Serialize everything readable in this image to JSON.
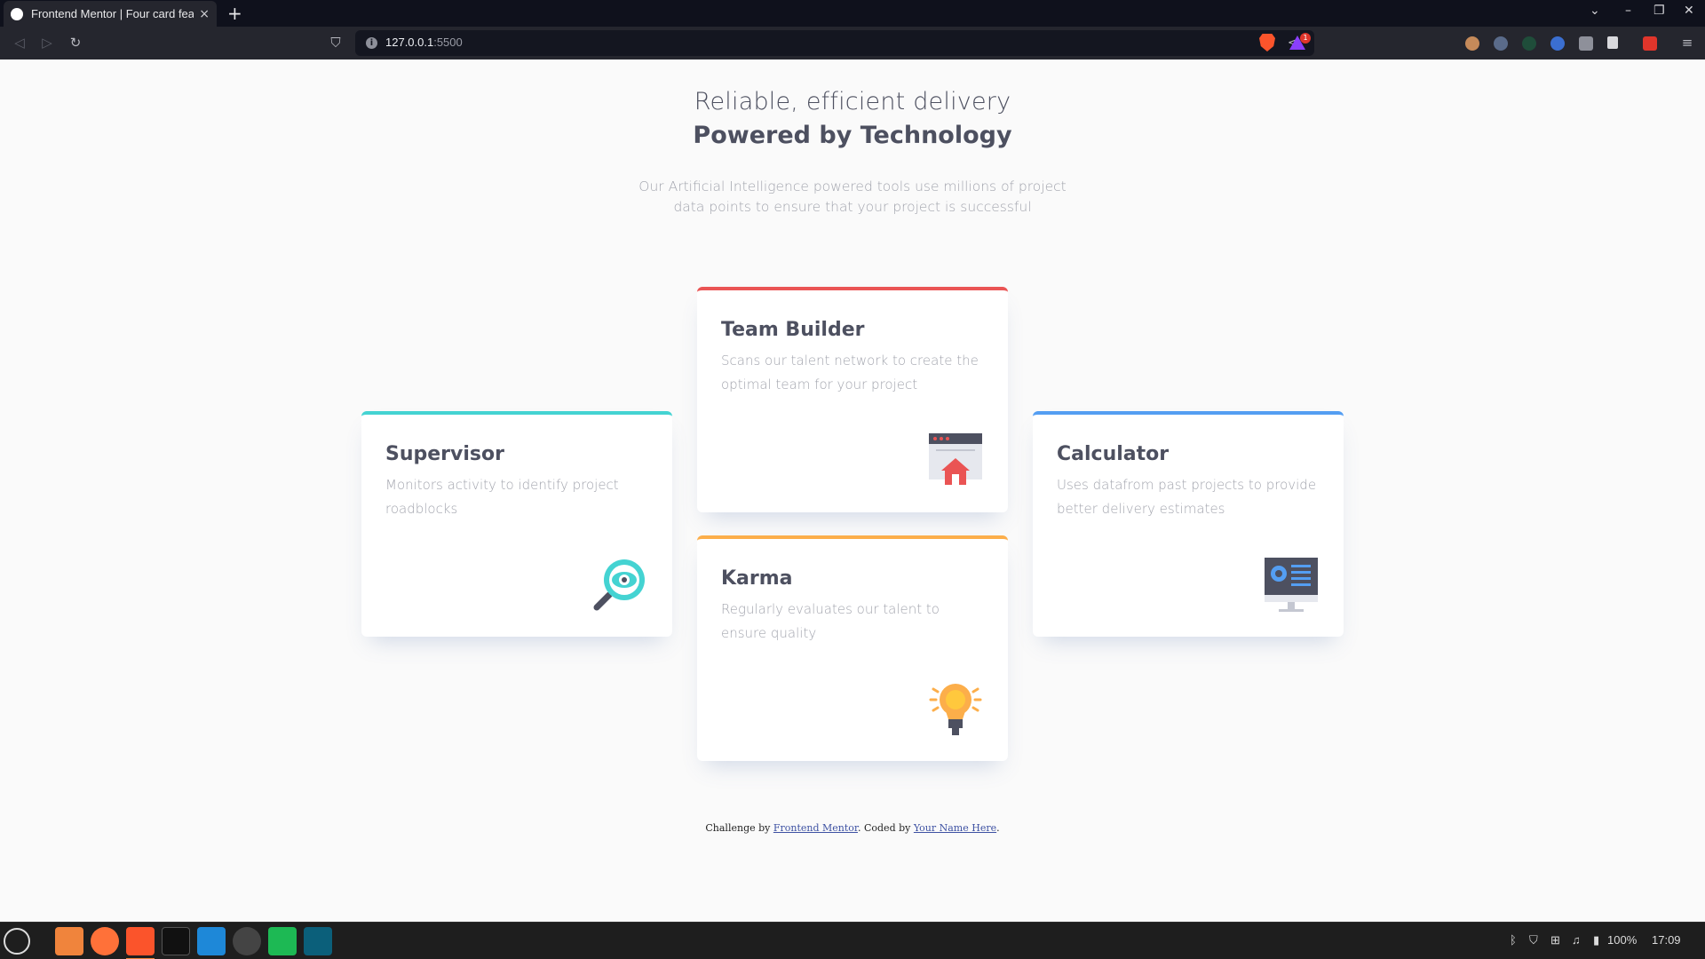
{
  "browser": {
    "tab_title": "Frontend Mentor | Four card feature section",
    "tab_close": "×",
    "new_tab": "+",
    "url_host": "127.0.0.1",
    "url_port": ":5500",
    "badge_count": "1",
    "window_controls": {
      "tab_search": "⌄",
      "minimize": "–",
      "restore": "❐",
      "close": "✕"
    }
  },
  "page": {
    "heading_light": "Reliable, efficient delivery",
    "heading_bold": "Powered by Technology",
    "intro": "Our Artificial Intelligence powered tools use millions of project data points to ensure that your project is successful",
    "cards": [
      {
        "title": "Supervisor",
        "desc": "Monitors activity to identify project roadblocks",
        "accent": "#44d3d2",
        "icon": "magnifier-eye-icon"
      },
      {
        "title": "Team Builder",
        "desc": "Scans our talent network to create the optimal team for your project",
        "accent": "#ea5454",
        "icon": "browser-window-icon"
      },
      {
        "title": "Karma",
        "desc": "Regularly evaluates our talent to ensure quality",
        "accent": "#fcae4a",
        "icon": "lightbulb-icon"
      },
      {
        "title": "Calculator",
        "desc": "Uses datafrom past projects to provide better delivery estimates",
        "accent": "#549ef2",
        "icon": "monitor-icon"
      }
    ],
    "footer": {
      "prefix": "Challenge by ",
      "link1": "Frontend Mentor",
      "middle": ". Coded by ",
      "link2": "Your Name Here",
      "suffix": "."
    }
  },
  "taskbar": {
    "volume": "100%",
    "clock": "17:09"
  },
  "colors": {
    "heading": "#4d5060",
    "text_grey": "#a3a5ae",
    "background": "#fafafa"
  }
}
